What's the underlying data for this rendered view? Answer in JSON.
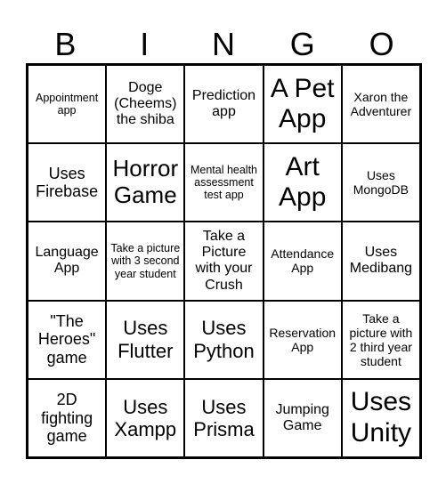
{
  "header": [
    "B",
    "I",
    "N",
    "G",
    "O"
  ],
  "cells": [
    {
      "text": "Appointment app",
      "size": "s1"
    },
    {
      "text": "Doge (Cheems) the shiba",
      "size": "s3"
    },
    {
      "text": "Prediction app",
      "size": "s3"
    },
    {
      "text": "A Pet App",
      "size": "s7"
    },
    {
      "text": "Xaron the Adventurer",
      "size": "s2"
    },
    {
      "text": "Uses Firebase",
      "size": "s4"
    },
    {
      "text": "Horror Game",
      "size": "s6"
    },
    {
      "text": "Mental health assessment test app",
      "size": "s1"
    },
    {
      "text": "Art App",
      "size": "s7"
    },
    {
      "text": "Uses MongoDB",
      "size": "s2"
    },
    {
      "text": "Language App",
      "size": "s3"
    },
    {
      "text": "Take a picture with 3 second year student",
      "size": "s1"
    },
    {
      "text": "Take a Picture with your Crush",
      "size": "s3"
    },
    {
      "text": "Attendance App",
      "size": "s2"
    },
    {
      "text": "Uses Medibang",
      "size": "s3"
    },
    {
      "text": "\"The Heroes\" game",
      "size": "s4"
    },
    {
      "text": "Uses Flutter",
      "size": "s5"
    },
    {
      "text": "Uses Python",
      "size": "s5"
    },
    {
      "text": "Reservation App",
      "size": "s2"
    },
    {
      "text": "Take a picture with 2 third year student",
      "size": "s2"
    },
    {
      "text": "2D fighting game",
      "size": "s4"
    },
    {
      "text": "Uses Xampp",
      "size": "s5"
    },
    {
      "text": "Uses Prisma",
      "size": "s5"
    },
    {
      "text": "Jumping Game",
      "size": "s3"
    },
    {
      "text": "Uses Unity",
      "size": "s7"
    }
  ]
}
